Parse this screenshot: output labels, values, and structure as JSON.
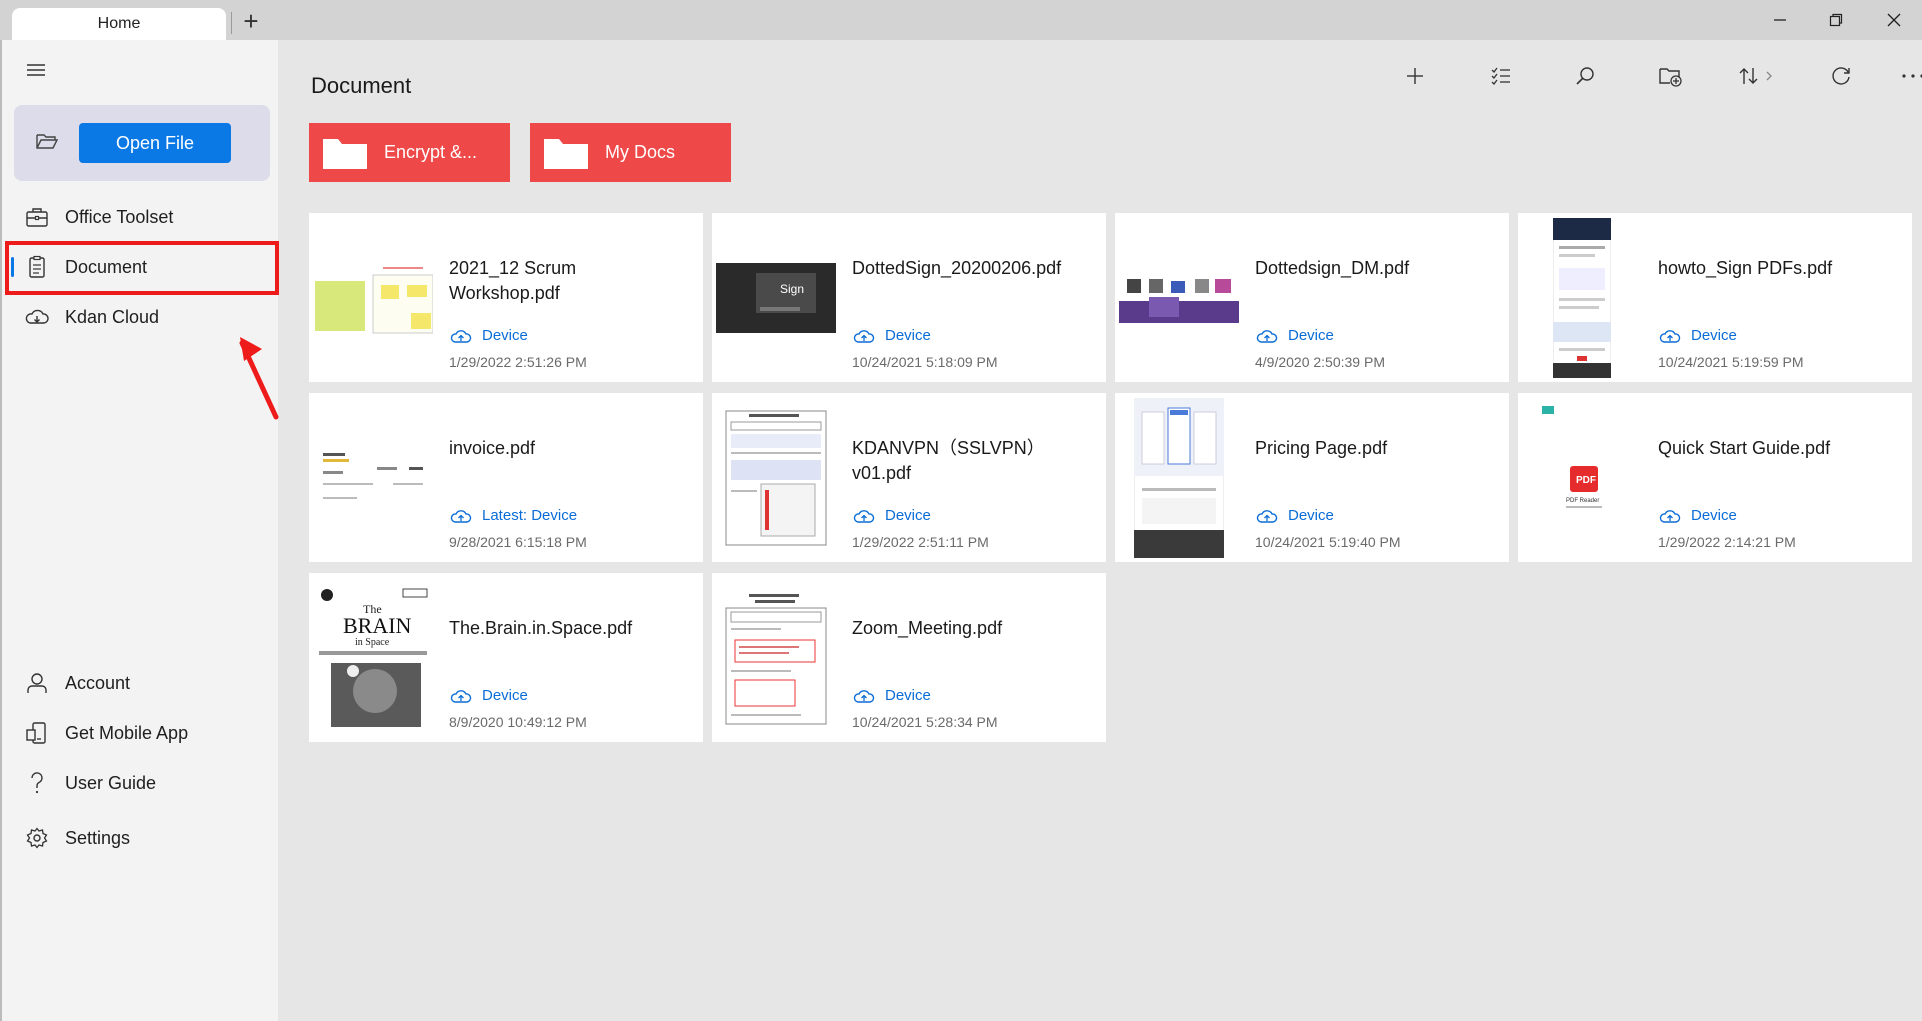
{
  "window": {
    "tab_title": "Home",
    "new_tab_glyph": "+"
  },
  "sidebar": {
    "open_file_label": "Open File",
    "items": [
      {
        "label": "Office Toolset",
        "icon": "toolbox-icon"
      },
      {
        "label": "Document",
        "icon": "document-icon",
        "selected": true
      },
      {
        "label": "Kdan Cloud",
        "icon": "cloud-icon"
      }
    ],
    "bottom_items": [
      {
        "label": "Account",
        "icon": "person-icon"
      },
      {
        "label": "Get Mobile App",
        "icon": "mobile-app-icon"
      },
      {
        "label": "User Guide",
        "icon": "question-icon"
      },
      {
        "label": "Settings",
        "icon": "gear-icon"
      }
    ]
  },
  "main": {
    "title": "Document",
    "toolbar": [
      {
        "name": "add",
        "icon": "plus-icon"
      },
      {
        "name": "select",
        "icon": "checklist-icon"
      },
      {
        "name": "search",
        "icon": "search-icon"
      },
      {
        "name": "new-folder",
        "icon": "new-folder-icon"
      },
      {
        "name": "sort",
        "icon": "sort-icon"
      },
      {
        "name": "refresh",
        "icon": "refresh-icon"
      },
      {
        "name": "more",
        "icon": "more-icon"
      }
    ],
    "folders": [
      {
        "label": "Encrypt &..."
      },
      {
        "label": "My Docs"
      }
    ],
    "files": [
      {
        "name": "2021_12 Scrum Workshop.pdf",
        "location": "Device",
        "date": "1/29/2022 2:51:26 PM"
      },
      {
        "name": "DottedSign_20200206.pdf",
        "location": "Device",
        "date": "10/24/2021 5:18:09 PM"
      },
      {
        "name": "Dottedsign_DM.pdf",
        "location": "Device",
        "date": "4/9/2020 2:50:39 PM"
      },
      {
        "name": "howto_Sign PDFs.pdf",
        "location": "Device",
        "date": "10/24/2021 5:19:59 PM"
      },
      {
        "name": "invoice.pdf",
        "location": "Latest: Device",
        "date": "9/28/2021 6:15:18 PM"
      },
      {
        "name": "KDANVPN（SSLVPN）v01.pdf",
        "location": "Device",
        "date": "1/29/2022 2:51:11 PM"
      },
      {
        "name": "Pricing Page.pdf",
        "location": "Device",
        "date": "10/24/2021 5:19:40 PM"
      },
      {
        "name": "Quick Start Guide.pdf",
        "location": "Device",
        "date": "1/29/2022 2:14:21 PM"
      },
      {
        "name": "The.Brain.in.Space.pdf",
        "location": "Device",
        "date": "8/9/2020 10:49:12 PM"
      },
      {
        "name": "Zoom_Meeting.pdf",
        "location": "Device",
        "date": "10/24/2021 5:28:34 PM"
      }
    ],
    "thumb_text": {
      "dottedsign_logo": "Sign",
      "brain_title": "The",
      "brain_big": "BRAIN",
      "brain_sub": "in Space",
      "pdf_badge": "PDF",
      "pdf_reader": "PDF Reader"
    }
  },
  "colors": {
    "accent": "#0a79e6",
    "folder": "#ef4848",
    "highlight": "#ee1b1b"
  }
}
